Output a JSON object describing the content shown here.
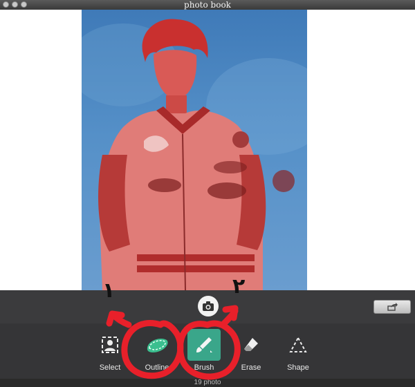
{
  "window": {
    "title": "photo book"
  },
  "toolbar": {
    "camera_icon": "camera-icon",
    "share_icon": "share-icon"
  },
  "tools": [
    {
      "label": "Select",
      "icon": "person-select-icon"
    },
    {
      "label": "Outline",
      "icon": "lasso-outline-icon"
    },
    {
      "label": "Brush",
      "icon": "brush-icon",
      "active": true
    },
    {
      "label": "Erase",
      "icon": "eraser-icon"
    },
    {
      "label": "Shape",
      "icon": "triangle-shape-icon"
    }
  ],
  "status": {
    "text": "19 photo"
  },
  "annotations": {
    "marker_1": "١",
    "marker_2": "٢"
  },
  "colors": {
    "annotation_red": "#e8202a",
    "active_tool": "#3aa68a",
    "sky": "#4f8ac2"
  }
}
